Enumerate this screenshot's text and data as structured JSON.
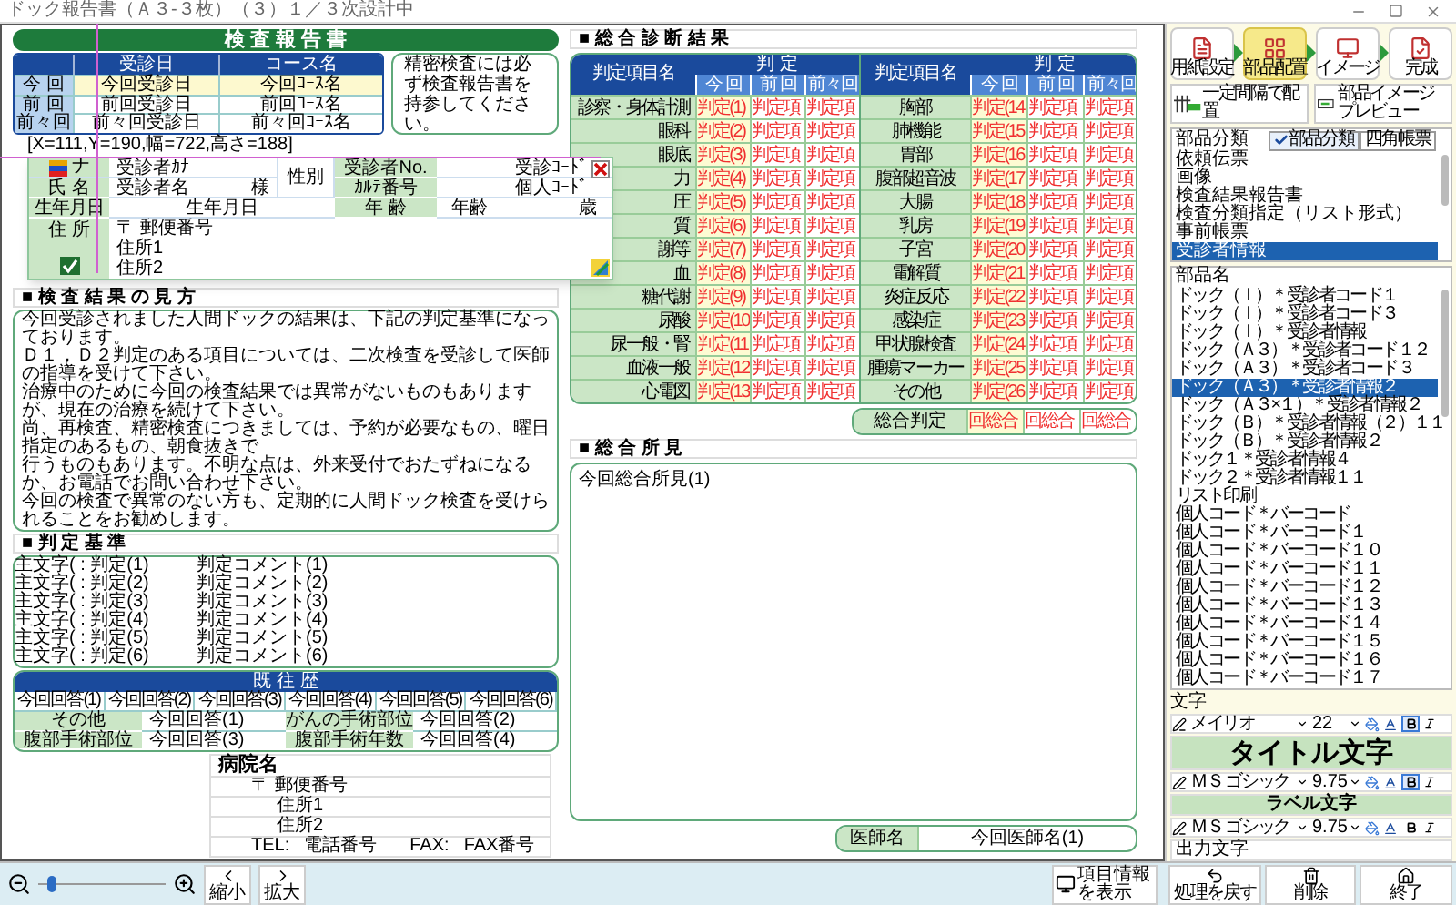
{
  "window": {
    "title": "ドック報告書（Ａ３-３枚）（３）１／３次設計中"
  },
  "report": {
    "title": "検 査 報 告 書",
    "visits": {
      "columns": [
        "受診日",
        "コース名"
      ],
      "rows": [
        {
          "label": "今 回",
          "date": "今回受診日",
          "course": "今回ｺｰｽ名",
          "highlighted": true
        },
        {
          "label": "前 回",
          "date": "前回受診日",
          "course": "前回ｺｰｽ名",
          "highlighted": false
        },
        {
          "label": "前々回",
          "date": "前々回受診日",
          "course": "前々回ｺｰｽ名",
          "highlighted": false
        }
      ]
    },
    "note": "精密検査には必ず検査報告書を持参してください。",
    "tooltip": "[X=111,Y=190,幅=722,高さ=188]",
    "patient": {
      "kana_label": "ナ",
      "kana": "受診者ｶﾅ",
      "gender_label": "性別",
      "no_label": "受診者No.",
      "no": "受診ｺｰﾄﾞ",
      "name_label": "氏 名",
      "name": "受診者名",
      "honorific": "様",
      "chart_label": "ｶﾙﾃ番号",
      "chart": "個人ｺｰﾄﾞ",
      "birth_label": "生年月日",
      "birth": "生年月日",
      "age_label": "年 齢",
      "age": "年齢",
      "age_unit": "歳",
      "address_label": "住 所",
      "postal": "〒 郵便番号",
      "address1": "住所1",
      "address2": "住所2"
    },
    "guide": {
      "heading": "■ 検 査 結 果 の 見 方",
      "lines": [
        "今回受診されました人間ドックの結果は、下記の判定基準になっております。",
        "Ｄ１，Ｄ２判定のある項目については、二次検査を受診して医師の指導を受けて下さい。",
        "治療中のために今回の検査結果では異常がないものもありますが、現在の治療を続けて下さい。",
        "尚、再検査、精密検査につきましては、予約が必要なもの、曜日指定のあるもの、朝食抜きで",
        "行うものもあります。不明な点は、外来受付でおたずねになるか、お電話でお問い合わせ下さい。",
        "今回の検査で異常のない方も、定期的に人間ドック検査を受けられることをお勧めします。"
      ]
    },
    "criteria": {
      "heading": "■ 判 定 基 準",
      "rows": [
        {
          "code": "主文字( : 判定(1)",
          "comment": "判定コメント(1)"
        },
        {
          "code": "主文字( : 判定(2)",
          "comment": "判定コメント(2)"
        },
        {
          "code": "主文字( : 判定(3)",
          "comment": "判定コメント(3)"
        },
        {
          "code": "主文字( : 判定(4)",
          "comment": "判定コメント(4)"
        },
        {
          "code": "主文字( : 判定(5)",
          "comment": "判定コメント(5)"
        },
        {
          "code": "主文字( : 判定(6)",
          "comment": "判定コメント(6)"
        }
      ]
    },
    "history": {
      "heading": "既 往 歴",
      "answers": [
        "今回回答(1)",
        "今回回答(2)",
        "今回回答(3)",
        "今回回答(4)",
        "今回回答(5)",
        "今回回答(6)"
      ],
      "fields": [
        {
          "label": "その他",
          "value": "今回回答(1)"
        },
        {
          "label": "がんの手術部位",
          "value": "今回回答(2)"
        },
        {
          "label": "腹部手術部位",
          "value": "今回回答(3)"
        },
        {
          "label": "腹部手術年数",
          "value": "今回回答(4)"
        }
      ]
    },
    "hospital": {
      "name": "病院名",
      "postal": "〒 郵便番号",
      "address1": "住所1",
      "address2": "住所2",
      "tel_label": "TEL:",
      "tel": "電話番号",
      "fax_label": "FAX:",
      "fax": "FAX番号"
    },
    "diagnosis": {
      "heading": "■ 総 合 診 断 結 果",
      "halves": [
        {
          "item_header": "判定項目名",
          "judgement_header": "判 定",
          "periods": [
            "今 回",
            "前 回",
            "前々回"
          ],
          "rows": [
            {
              "label": "診察・身体計測",
              "values": [
                "判定(1)",
                "判定項",
                "判定項"
              ]
            },
            {
              "label": "眼科",
              "values": [
                "判定(2)",
                "判定項",
                "判定項"
              ]
            },
            {
              "label": "眼底",
              "values": [
                "判定(3)",
                "判定項",
                "判定項"
              ]
            },
            {
              "label": "力",
              "values": [
                "判定(4)",
                "判定項",
                "判定項"
              ]
            },
            {
              "label": "圧",
              "values": [
                "判定(5)",
                "判定項",
                "判定項"
              ]
            },
            {
              "label": "質",
              "values": [
                "判定(6)",
                "判定項",
                "判定項"
              ]
            },
            {
              "label": "謝等",
              "values": [
                "判定(7)",
                "判定項",
                "判定項"
              ]
            },
            {
              "label": "血",
              "values": [
                "判定(8)",
                "判定項",
                "判定項"
              ]
            },
            {
              "label": "糖代謝",
              "values": [
                "判定(9)",
                "判定項",
                "判定項"
              ]
            },
            {
              "label": "尿酸",
              "values": [
                "判定(10",
                "判定項",
                "判定項"
              ]
            },
            {
              "label": "尿一般・腎",
              "values": [
                "判定(11",
                "判定項",
                "判定項"
              ]
            },
            {
              "label": "血液一般",
              "values": [
                "判定(12",
                "判定項",
                "判定項"
              ]
            },
            {
              "label": "心電図",
              "values": [
                "判定(13",
                "判定項",
                "判定項"
              ]
            }
          ]
        },
        {
          "item_header": "判定項目名",
          "judgement_header": "判 定",
          "periods": [
            "今 回",
            "前 回",
            "前々回"
          ],
          "rows": [
            {
              "label": "胸部",
              "values": [
                "判定(14",
                "判定項",
                "判定項"
              ]
            },
            {
              "label": "肺機能",
              "values": [
                "判定(15",
                "判定項",
                "判定項"
              ]
            },
            {
              "label": "胃部",
              "values": [
                "判定(16",
                "判定項",
                "判定項"
              ]
            },
            {
              "label": "腹部超音波",
              "values": [
                "判定(17",
                "判定項",
                "判定項"
              ]
            },
            {
              "label": "大腸",
              "values": [
                "判定(18",
                "判定項",
                "判定項"
              ]
            },
            {
              "label": "乳房",
              "values": [
                "判定(19",
                "判定項",
                "判定項"
              ]
            },
            {
              "label": "子宮",
              "values": [
                "判定(20",
                "判定項",
                "判定項"
              ]
            },
            {
              "label": "電解質",
              "values": [
                "判定(21",
                "判定項",
                "判定項"
              ]
            },
            {
              "label": "炎症反応",
              "values": [
                "判定(22",
                "判定項",
                "判定項"
              ]
            },
            {
              "label": "感染症",
              "values": [
                "判定(23",
                "判定項",
                "判定項"
              ]
            },
            {
              "label": "甲状腺検査",
              "values": [
                "判定(24",
                "判定項",
                "判定項"
              ]
            },
            {
              "label": "腫瘍マーカー",
              "values": [
                "判定(25",
                "判定項",
                "判定項"
              ]
            },
            {
              "label": "その他",
              "values": [
                "判定(26",
                "判定項",
                "判定項"
              ]
            }
          ]
        }
      ]
    },
    "overall": {
      "label": "総合判定",
      "values": [
        "回総合",
        "回総合",
        "回総合"
      ]
    },
    "findings": {
      "heading": "■ 総 合 所 見",
      "text": "今回総合所見(1)"
    },
    "doctor": {
      "label": "医師名",
      "value": "今回医師名(1)"
    }
  },
  "sidebar": {
    "steps": [
      {
        "label": "用紙設定",
        "selected": false
      },
      {
        "label": "部品配置",
        "selected": true
      },
      {
        "label": "イメージ",
        "selected": false
      },
      {
        "label": "完成",
        "selected": false
      }
    ],
    "tools": [
      "一定間隔で配置",
      "部品イメージプレビュー"
    ],
    "categories": {
      "header": "部品分類",
      "toggles": [
        {
          "label": "部品分類",
          "checked": true
        },
        {
          "label": "四角帳票",
          "checked": false
        }
      ],
      "items": [
        {
          "label": "依頼伝票",
          "selected": false
        },
        {
          "label": "画像",
          "selected": false
        },
        {
          "label": "検査結果報告書",
          "selected": false
        },
        {
          "label": "検査分類指定（リスト形式）",
          "selected": false
        },
        {
          "label": "事前帳票",
          "selected": false
        },
        {
          "label": "受診者情報",
          "selected": true
        }
      ]
    },
    "parts": {
      "header": "部品名",
      "items": [
        {
          "label": "ドック（Ｉ）＊受診者コード１",
          "selected": false
        },
        {
          "label": "ドック（Ｉ）＊受診者コード３",
          "selected": false
        },
        {
          "label": "ドック（Ｉ）＊受診者情報",
          "selected": false
        },
        {
          "label": "ドック（Ａ３）＊受診者コード１２",
          "selected": false
        },
        {
          "label": "ドック（Ａ３）＊受診者コード３",
          "selected": false
        },
        {
          "label": "ドック（Ａ３）＊受診者情報２",
          "selected": true
        },
        {
          "label": "ドック（Ａ３×１）＊受診者情報２",
          "selected": false
        },
        {
          "label": "ドック（Ｂ）＊受診者情報（２）１１",
          "selected": false
        },
        {
          "label": "ドック（Ｂ）＊受診者情報２",
          "selected": false
        },
        {
          "label": "ドック１＊受診者情報４",
          "selected": false
        },
        {
          "label": "ドック２＊受診者情報１１",
          "selected": false
        },
        {
          "label": "リスト印刷",
          "selected": false
        },
        {
          "label": "個人コード＊バーコード",
          "selected": false
        },
        {
          "label": "個人コード＊バーコード１",
          "selected": false
        },
        {
          "label": "個人コード＊バーコード１０",
          "selected": false
        },
        {
          "label": "個人コード＊バーコード１１",
          "selected": false
        },
        {
          "label": "個人コード＊バーコード１２",
          "selected": false
        },
        {
          "label": "個人コード＊バーコード１３",
          "selected": false
        },
        {
          "label": "個人コード＊バーコード１４",
          "selected": false
        },
        {
          "label": "個人コード＊バーコード１５",
          "selected": false
        },
        {
          "label": "個人コード＊バーコード１６",
          "selected": false
        },
        {
          "label": "個人コード＊バーコード１７",
          "selected": false
        }
      ]
    },
    "text_style": {
      "heading": "文字",
      "rows": [
        {
          "kind": "font",
          "font": "メイリオ",
          "size": "22",
          "bold": true
        },
        {
          "kind": "title",
          "text": "タイトル文字"
        },
        {
          "kind": "font",
          "font": "ＭＳ ゴシック",
          "size": "9.75",
          "bold": true
        },
        {
          "kind": "label",
          "text": "ラベル文字"
        },
        {
          "kind": "font",
          "font": "ＭＳ ゴシック",
          "size": "9.75",
          "bold": false
        },
        {
          "kind": "output",
          "text": "出力文字"
        }
      ]
    }
  },
  "bottom": {
    "zoom": {
      "level": 0.1
    },
    "shrink": "縮小",
    "enlarge": "拡大",
    "item_info": "項目情報を表示",
    "undo": "処理を戻す",
    "delete": "削除",
    "exit": "終了"
  }
}
